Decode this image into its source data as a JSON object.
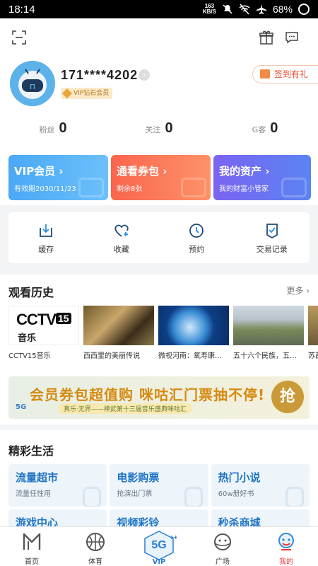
{
  "status_bar": {
    "time": "18:14",
    "net_speed_value": "163",
    "net_speed_unit": "KB/S",
    "battery": "68%"
  },
  "profile": {
    "username": "171****4202",
    "vip_badge": "VIP钻石会员",
    "signin_label": "签到有礼",
    "stats": [
      {
        "label": "粉丝",
        "value": "0"
      },
      {
        "label": "关注",
        "value": "0"
      },
      {
        "label": "G客",
        "value": "0"
      }
    ]
  },
  "cards": [
    {
      "title": "VIP会员 ›",
      "subtitle": "有效期2030/11/23",
      "color": "#4eaef5"
    },
    {
      "title": "通看券包 ›",
      "subtitle": "剩余8张",
      "color": "#fb7a57"
    },
    {
      "title": "我的资产 ›",
      "subtitle": "我的财富小管家",
      "color": "#7d6af3"
    }
  ],
  "quick_actions": [
    {
      "label": "缓存",
      "icon": "download-icon"
    },
    {
      "label": "收藏",
      "icon": "heart-plus-icon"
    },
    {
      "label": "预约",
      "icon": "clock-icon"
    },
    {
      "label": "交易记录",
      "icon": "receipt-check-icon"
    }
  ],
  "history": {
    "title": "观看历史",
    "more": "更多",
    "items": [
      {
        "caption": "CCTV15音乐",
        "thumb_text_main": "CCTV",
        "thumb_text_num": "15",
        "thumb_text_sub": "音乐"
      },
      {
        "caption": "西西里的美丽传说"
      },
      {
        "caption": "微视河南：氧寿康…"
      },
      {
        "caption": "五十六个民族，五…"
      },
      {
        "caption": "苏西"
      }
    ]
  },
  "banner": {
    "main_text": "会员券包超值购  咪咕汇门票抽不停!",
    "sub_text": "真乐·无界——神武第十三届音乐盛典咪咕汇",
    "grab": "抢",
    "fiveg": "5G"
  },
  "life": {
    "title": "精彩生活",
    "tiles": [
      {
        "title": "流量超市",
        "subtitle": "流量任性用"
      },
      {
        "title": "电影购票",
        "subtitle": "抢演出门票"
      },
      {
        "title": "热门小说",
        "subtitle": "60w册好书"
      },
      {
        "title": "游戏中心",
        "subtitle": ""
      },
      {
        "title": "视频彩铃",
        "subtitle": ""
      },
      {
        "title": "秒杀商城",
        "subtitle": ""
      }
    ]
  },
  "tabbar": {
    "tabs": [
      {
        "label": "首页"
      },
      {
        "label": "体育"
      },
      {
        "label": "VIP"
      },
      {
        "label": "广场"
      },
      {
        "label": "我的"
      }
    ],
    "active": "我的",
    "accent_color": "#e53935"
  }
}
